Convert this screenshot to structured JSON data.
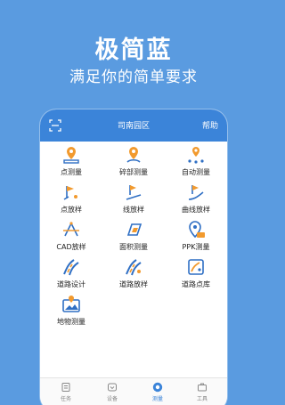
{
  "hero": {
    "title": "极简蓝",
    "subtitle": "满足你的简单要求"
  },
  "appbar": {
    "title": "司南园区",
    "help_label": "帮助",
    "scan_icon": "scan-icon"
  },
  "tools": [
    {
      "label": "点测量",
      "icon": "point-measure-icon"
    },
    {
      "label": "碎部测量",
      "icon": "detail-survey-icon"
    },
    {
      "label": "自动测量",
      "icon": "auto-measure-icon"
    },
    {
      "label": "点放样",
      "icon": "point-stakeout-icon"
    },
    {
      "label": "线放样",
      "icon": "line-stakeout-icon"
    },
    {
      "label": "曲线放样",
      "icon": "curve-stakeout-icon"
    },
    {
      "label": "CAD放样",
      "icon": "cad-stakeout-icon"
    },
    {
      "label": "面积测量",
      "icon": "area-measure-icon"
    },
    {
      "label": "PPK测量",
      "icon": "ppk-measure-icon"
    },
    {
      "label": "道路设计",
      "icon": "road-design-icon"
    },
    {
      "label": "道路放样",
      "icon": "road-stakeout-icon"
    },
    {
      "label": "道路点库",
      "icon": "road-point-library-icon"
    },
    {
      "label": "地物测量",
      "icon": "feature-survey-icon"
    }
  ],
  "tabs": [
    {
      "label": "任务",
      "icon": "task-icon",
      "active": false
    },
    {
      "label": "设备",
      "icon": "device-icon",
      "active": false
    },
    {
      "label": "测量",
      "icon": "measure-icon",
      "active": true
    },
    {
      "label": "工具",
      "icon": "toolbox-icon",
      "active": false
    }
  ],
  "colors": {
    "background": "#5a9be0",
    "appbar": "#3b84d9",
    "icon_blue": "#2f6fc4",
    "icon_orange": "#f29a2e"
  }
}
